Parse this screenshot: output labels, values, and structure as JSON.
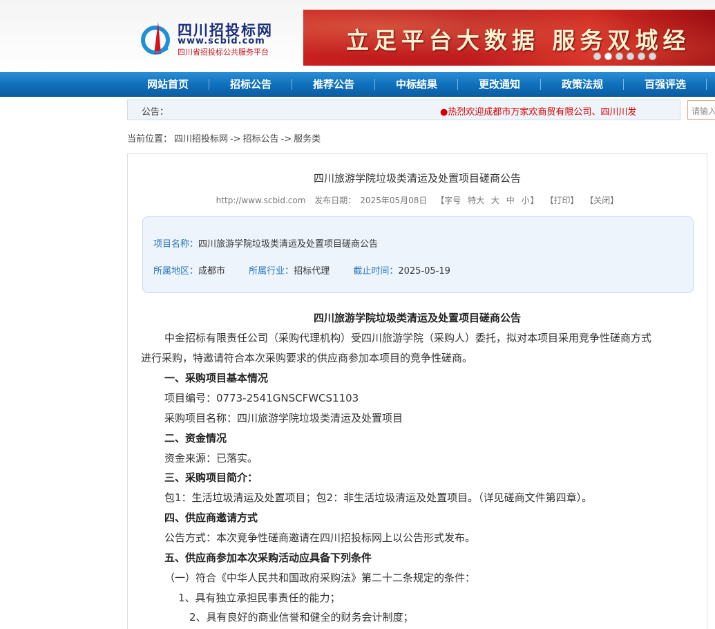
{
  "header": {
    "logo_title": "四川招投标网",
    "logo_url": "www.scbid.com",
    "logo_sub": "四川省招投标公共服务平台",
    "banner_text": "立足平台大数据 服务双城经",
    "banner_dots": [
      false,
      true,
      false,
      false,
      false,
      false
    ]
  },
  "nav": {
    "items": [
      "网站首页",
      "招标公告",
      "推荐公告",
      "中标结果",
      "更改通知",
      "政策法规",
      "百强评选"
    ]
  },
  "notice": {
    "label": "公告：",
    "scroll_text": "●热烈欢迎成都市万家欢商贸有限公司、四川川发",
    "search_placeholder": "请输入"
  },
  "breadcrumb": {
    "prefix": "当前位置：",
    "items": [
      "四川招投标网",
      "->",
      "招标公告",
      "->",
      "服务类"
    ]
  },
  "article": {
    "title": "四川旅游学院垃圾类清运及处置项目磋商公告",
    "site": "http://www.scbid.com",
    "publish_label": "发布日期：",
    "publish_date": "2025年05月08日",
    "font_label": "【字号",
    "font_options": [
      "特大",
      "大",
      "中",
      "小"
    ],
    "font_end": "】",
    "print": "【打印】",
    "close": "【关闭】"
  },
  "info": {
    "project_key": "项目名称：",
    "project_val": "四川旅游学院垃圾类清运及处置项目磋商公告",
    "region_key": "所属地区：",
    "region_val": "成都市",
    "industry_key": "所属行业：",
    "industry_val": "招标代理",
    "deadline_key": "截止时间：",
    "deadline_val": "2025-05-19"
  },
  "body": {
    "title": "四川旅游学院垃圾类清运及处置项目磋商公告",
    "intro_1": "中金招标有限责任公司（采购代理机构）受四川旅游学院（采购人）委托，拟对本项目采用竞争性磋商方式",
    "intro_2": "进行采购，特邀请符合本次采购要求的供应商参加本项目的竞争性磋商。",
    "h1": "一、采购项目基本情况",
    "p1a": "项目编号：0773-2541GNSCFWCS1103",
    "p1b": "采购项目名称：四川旅游学院垃圾类清运及处置项目",
    "h2": "二、资金情况",
    "p2": "资金来源：已落实。",
    "h3": "三、采购项目简介：",
    "p3": "包1：生活垃圾清运及处置项目；包2：非生活垃圾清运及处置项目。（详见磋商文件第四章）。",
    "h4": "四、供应商邀请方式",
    "p4": "公告方式：本次竞争性磋商邀请在四川招投标网上以公告形式发布。",
    "h5": "五、供应商参加本次采购活动应具备下列条件",
    "p5a": "（一）符合《中华人民共和国政府采购法》第二十二条规定的条件：",
    "p5b": "1、具有独立承担民事责任的能力；",
    "p5c": "2、具有良好的商业信誉和健全的财务会计制度；"
  }
}
